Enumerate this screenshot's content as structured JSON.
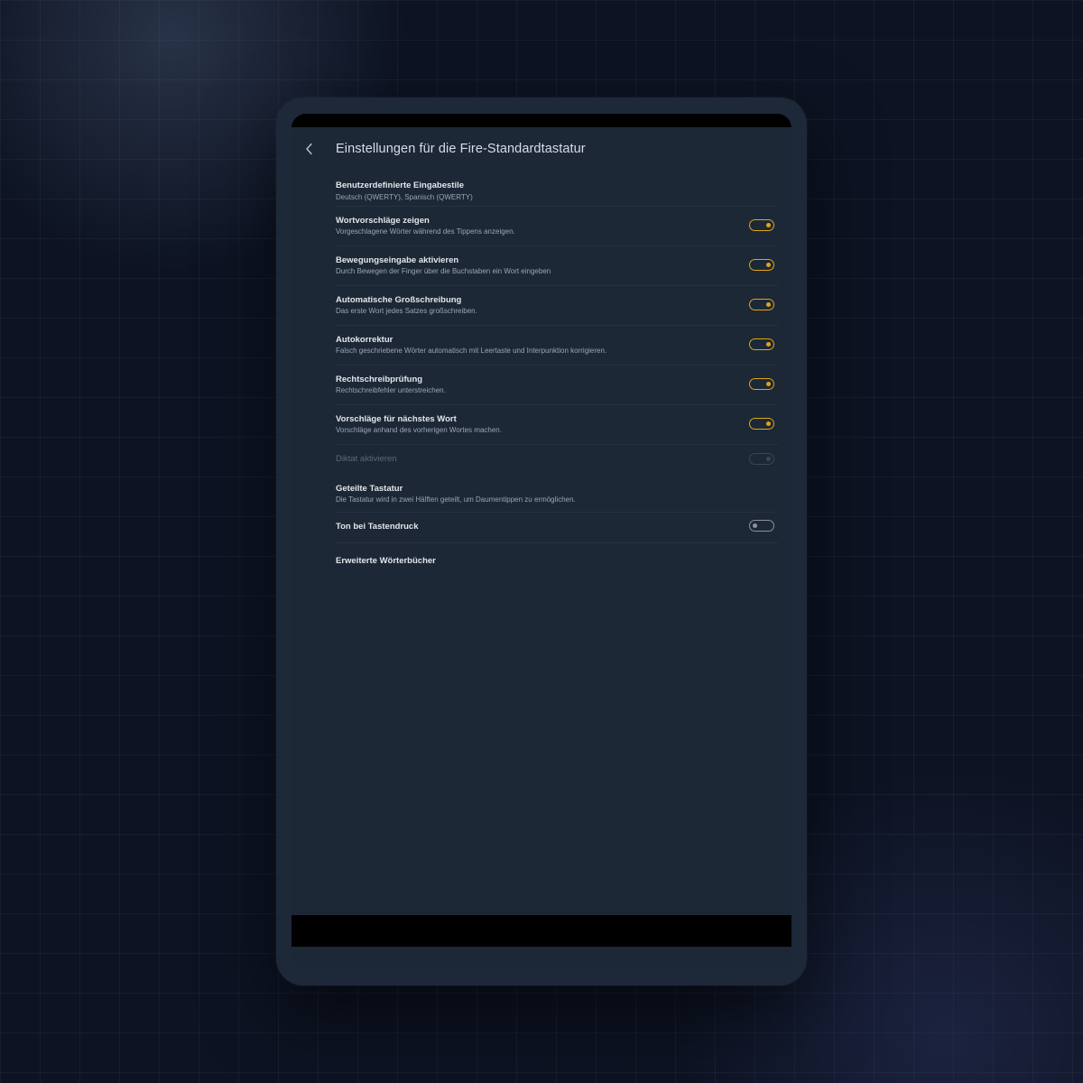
{
  "header": {
    "title": "Einstellungen für die Fire-Standardtastatur",
    "back_icon": "chevron-left-icon"
  },
  "colors": {
    "accent": "#e0a516",
    "screen_bg": "#1c2836",
    "device_bezel": "#1d2839",
    "page_bg": "#0d1322"
  },
  "settings": [
    {
      "title": "Benutzerdefinierte Eingabestile",
      "subtitle": "Deutsch (QWERTY), Spanisch (QWERTY)",
      "toggle": null,
      "enabled": true
    },
    {
      "title": "Wortvorschläge zeigen",
      "subtitle": "Vorgeschlagene Wörter während des Tippens anzeigen.",
      "toggle": "on",
      "enabled": true
    },
    {
      "title": "Bewegungseingabe aktivieren",
      "subtitle": "Durch Bewegen der Finger über die Buchstaben ein Wort eingeben",
      "toggle": "on",
      "enabled": true
    },
    {
      "title": "Automatische Großschreibung",
      "subtitle": "Das erste Wort jedes Satzes großschreiben.",
      "toggle": "on",
      "enabled": true
    },
    {
      "title": "Autokorrektur",
      "subtitle": "Falsch geschriebene Wörter automatisch mit Leertaste und Interpunktion korrigieren.",
      "toggle": "on",
      "enabled": true
    },
    {
      "title": "Rechtschreibprüfung",
      "subtitle": "Rechtschreibfehler unterstreichen.",
      "toggle": "on",
      "enabled": true
    },
    {
      "title": "Vorschläge für nächstes Wort",
      "subtitle": "Vorschläge anhand des vorherigen Wortes machen.",
      "toggle": "on",
      "enabled": true
    },
    {
      "title": "Diktat aktivieren",
      "subtitle": "",
      "toggle": "disabled",
      "enabled": false
    },
    {
      "title": "Geteilte Tastatur",
      "subtitle": "Die Tastatur wird in zwei Hälften geteilt, um Daumentippen zu ermöglichen.",
      "toggle": null,
      "enabled": true
    },
    {
      "title": "Ton bei Tastendruck",
      "subtitle": "",
      "toggle": "off",
      "enabled": true
    },
    {
      "title": "Erweiterte Wörterbücher",
      "subtitle": "",
      "toggle": null,
      "enabled": true
    }
  ]
}
